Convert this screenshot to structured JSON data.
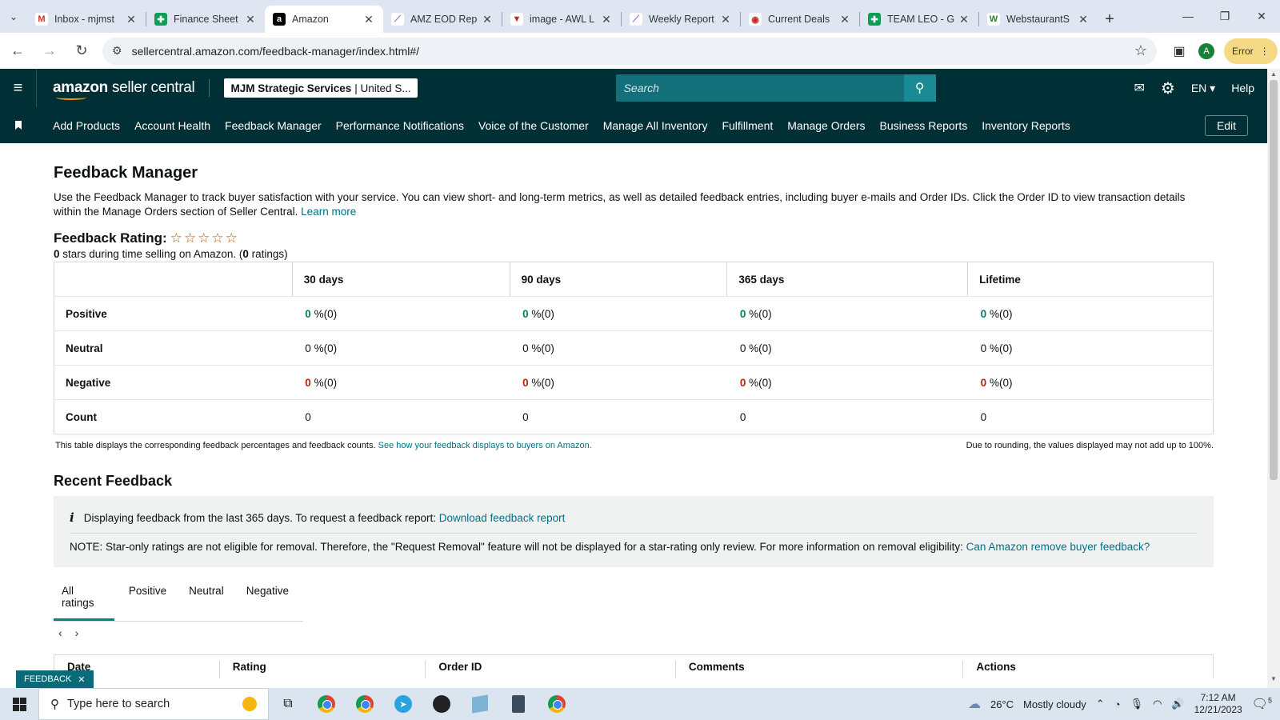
{
  "browser": {
    "tabs": [
      {
        "title": "Inbox - mjmst",
        "icon": "gmail-icon",
        "active": false
      },
      {
        "title": "Finance Sheet",
        "icon": "sheets-icon",
        "active": false
      },
      {
        "title": "Amazon",
        "icon": "amazon-icon",
        "active": true
      },
      {
        "title": "AMZ EOD Rep",
        "icon": "clickup-icon",
        "active": false
      },
      {
        "title": "image - AWL L",
        "icon": "awl-icon",
        "active": false
      },
      {
        "title": "Weekly Report",
        "icon": "clickup-icon",
        "active": false
      },
      {
        "title": "Current Deals",
        "icon": "deals-icon",
        "active": false
      },
      {
        "title": "TEAM LEO - G",
        "icon": "sheets-icon",
        "active": false
      },
      {
        "title": "WebstaurantS",
        "icon": "webstaurant-icon",
        "active": false
      }
    ],
    "url": "sellercentral.amazon.com/feedback-manager/index.html#/",
    "profile_initial": "A",
    "error_label": "Error"
  },
  "header": {
    "logo_bold": "amazon",
    "logo_rest": " seller central",
    "account_name": "MJM Strategic Services",
    "account_region": "| United S...",
    "search_placeholder": "Search",
    "language": "EN",
    "help": "Help"
  },
  "nav": {
    "links": [
      "Add Products",
      "Account Health",
      "Feedback Manager",
      "Performance Notifications",
      "Voice of the Customer",
      "Manage All Inventory",
      "Fulfillment",
      "Manage Orders",
      "Business Reports",
      "Inventory Reports"
    ],
    "edit": "Edit"
  },
  "page": {
    "title": "Feedback Manager",
    "intro": "Use the Feedback Manager to track buyer satisfaction with your service. You can view short- and long-term metrics, as well as detailed feedback entries, including buyer e-mails and Order IDs. Click the Order ID to view transaction details within the Manage Orders section of Seller Central.",
    "learn_more": "Learn more",
    "rating_title": "Feedback Rating:",
    "stars": "☆☆☆☆☆",
    "rating_count": "0",
    "rating_sub_mid": " stars during time selling on Amazon. (",
    "rating_ratings": "0",
    "rating_sub_end": " ratings)",
    "table": {
      "columns": [
        "30 days",
        "90 days",
        "365 days",
        "Lifetime"
      ],
      "rows": [
        {
          "label": "Positive",
          "kind": "g",
          "cells": [
            {
              "num": "0",
              "rest": " %(0)"
            },
            {
              "num": "0",
              "rest": " %(0)"
            },
            {
              "num": "0",
              "rest": " %(0)"
            },
            {
              "num": "0",
              "rest": " %(0)"
            }
          ]
        },
        {
          "label": "Neutral",
          "kind": "n",
          "cells": [
            {
              "num": "0",
              "rest": " %(0)"
            },
            {
              "num": "0",
              "rest": " %(0)"
            },
            {
              "num": "0",
              "rest": " %(0)"
            },
            {
              "num": "0",
              "rest": " %(0)"
            }
          ]
        },
        {
          "label": "Negative",
          "kind": "r",
          "cells": [
            {
              "num": "0",
              "rest": " %(0)"
            },
            {
              "num": "0",
              "rest": " %(0)"
            },
            {
              "num": "0",
              "rest": " %(0)"
            },
            {
              "num": "0",
              "rest": " %(0)"
            }
          ]
        },
        {
          "label": "Count",
          "kind": "n",
          "cells": [
            {
              "num": "0",
              "rest": ""
            },
            {
              "num": "0",
              "rest": ""
            },
            {
              "num": "0",
              "rest": ""
            },
            {
              "num": "0",
              "rest": ""
            }
          ]
        }
      ]
    },
    "table_note": "This table displays the corresponding feedback percentages and feedback counts.",
    "table_note_link": "See how your feedback displays to buyers on Amazon.",
    "rounding_note": "Due to rounding, the values displayed may not add up to 100%.",
    "recent_title": "Recent Feedback",
    "info_text": "Displaying feedback from the last 365 days. To request a feedback report:",
    "info_link": "Download feedback report",
    "note_text": "NOTE: Star-only ratings are not eligible for removal. Therefore, the \"Request Removal\" feature will not be displayed for a star-rating only review. For more information on removal eligibility:",
    "note_link": "Can Amazon remove buyer feedback?",
    "filter_tabs": [
      "All ratings",
      "Positive",
      "Neutral",
      "Negative"
    ],
    "recent_columns": [
      "Date",
      "Rating",
      "Order ID",
      "Comments",
      "Actions"
    ],
    "feedback_toggle": "FEEDBACK"
  },
  "taskbar": {
    "search_placeholder": "Type here to search",
    "weather_temp": "26°C",
    "weather_desc": "Mostly cloudy",
    "time": "7:12 AM",
    "date": "12/21/2023",
    "notif_count": "5"
  }
}
